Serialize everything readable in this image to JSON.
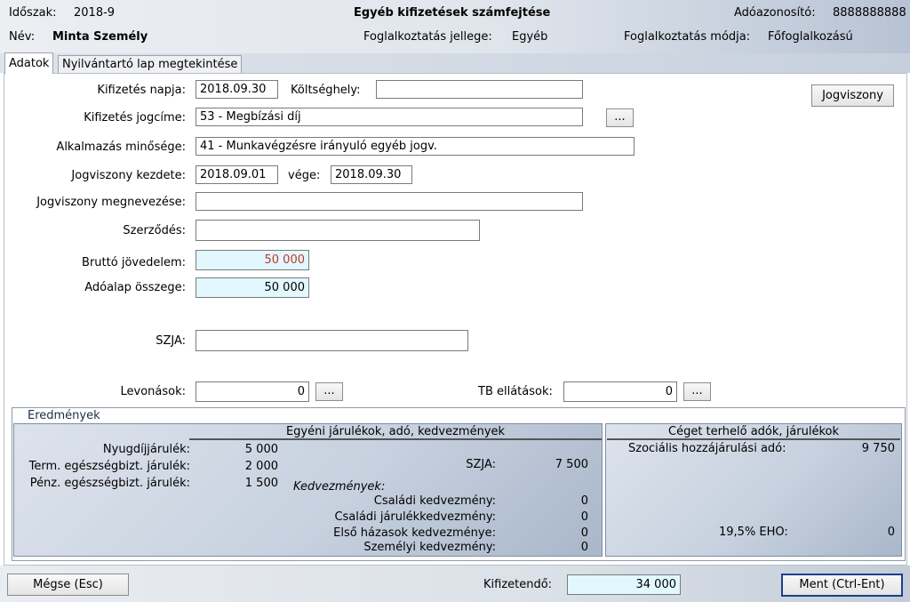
{
  "header": {
    "period_label": "Időszak:",
    "period_value": "2018-9",
    "title": "Egyéb kifizetések számfejtése",
    "tax_id_label": "Adóazonosító:",
    "tax_id_value": "8888888888",
    "name_label": "Név:",
    "name_value": "Minta Személy",
    "employment_type_label": "Foglalkoztatás jellege:",
    "employment_type_value": "Egyéb",
    "employment_mode_label": "Foglalkoztatás módja:",
    "employment_mode_value": "Főfoglalkozású"
  },
  "tabs": [
    "Adatok",
    "Nyilvántartó lap megtekintése"
  ],
  "form": {
    "payment_date_label": "Kifizetés napja:",
    "payment_date_value": "2018.09.30",
    "cost_center_label": "Költséghely:",
    "cost_center_value": "",
    "payment_title_label": "Kifizetés jogcíme:",
    "payment_title_value": "53 - Megbízási díj",
    "ellipsis": "...",
    "employment_quality_label": "Alkalmazás minősége:",
    "employment_quality_value": "41 - Munkavégzésre irányuló egyéb jogv.",
    "legal_start_label": "Jogviszony kezdete:",
    "legal_start_value": "2018.09.01",
    "legal_end_label": "vége:",
    "legal_end_value": "2018.09.30",
    "legal_name_label": "Jogviszony megnevezése:",
    "legal_name_value": "",
    "contract_label": "Szerződés:",
    "contract_value": "",
    "gross_income_label": "Bruttó jövedelem:",
    "gross_income_value": "50 000",
    "tax_base_label": "Adóalap összege:",
    "tax_base_value": "50 000",
    "szja_label": "SZJA:",
    "szja_value": "",
    "deductions_label": "Levonások:",
    "deductions_value": "0",
    "tb_label": "TB ellátások:",
    "tb_value": "0",
    "legal_button": "Jogviszony"
  },
  "results": {
    "title": "Eredmények",
    "individual": {
      "title": "Egyéni járulékok, adó, kedvezmények",
      "rows": [
        {
          "label": "Nyugdíjjárulék:",
          "value": "5 000"
        },
        {
          "label": "Term. egészségbizt. járulék:",
          "value": "2 000"
        },
        {
          "label": "Pénz. egészségbizt. járulék:",
          "value": "1 500"
        }
      ],
      "szja_label": "SZJA:",
      "szja_value": "7 500",
      "discounts_title": "Kedvezmények:",
      "discounts": [
        {
          "label": "Családi kedvezmény:",
          "value": "0"
        },
        {
          "label": "Családi járulékkedvezmény:",
          "value": "0"
        },
        {
          "label": "Első házasok kedvezménye:",
          "value": "0"
        },
        {
          "label": "Személyi kedvezmény:",
          "value": "0"
        }
      ]
    },
    "company": {
      "title": "Céget terhelő adók, járulékok",
      "social_label": "Szociális hozzájárulási adó:",
      "social_value": "9 750",
      "eho_label": "19,5% EHO:",
      "eho_value": "0"
    }
  },
  "footer": {
    "cancel_button": "Mégse (Esc)",
    "payable_label": "Kifizetendő:",
    "payable_value": "34 000",
    "save_button": "Ment (Ctrl-Ent)"
  },
  "colors": {
    "gross_value_text": "#c0392b",
    "cyan_field": "#e2f8fe",
    "underline": "#c9825a"
  }
}
